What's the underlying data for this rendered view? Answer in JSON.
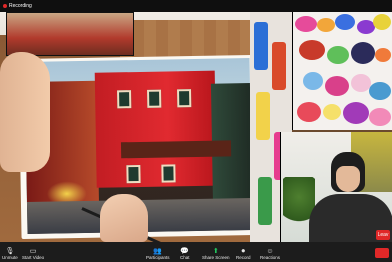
{
  "window": {
    "recording_label": "Recording"
  },
  "toolbar": {
    "mute_label": "Unmute",
    "video_label": "Start Video",
    "participants_label": "Participants",
    "chat_label": "Chat",
    "share_label": "Share Screen",
    "record_label": "Record",
    "reactions_label": "Reactions"
  },
  "webcam_tile": {
    "leave_label": "Leav"
  },
  "icons": {
    "mute": "microphone-muted-icon",
    "video": "video-camera-off-icon",
    "participants": "participants-icon",
    "chat": "chat-bubble-icon",
    "share": "share-screen-icon",
    "record": "record-icon",
    "reactions": "emoji-reaction-icon"
  },
  "colors": {
    "accent_share": "#23c55e",
    "leave_red": "#e02828",
    "toolbar_bg": "#1c1c1c"
  }
}
